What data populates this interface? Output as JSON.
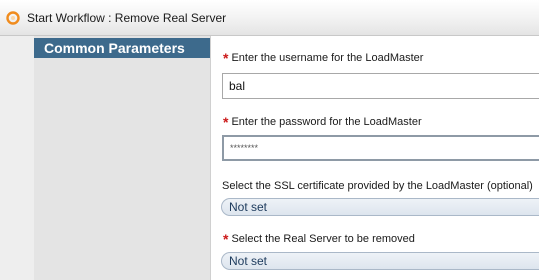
{
  "window": {
    "title": "Start Workflow : Remove Real Server"
  },
  "sidebar": {
    "items": [
      {
        "label": "Common Parameters"
      }
    ]
  },
  "form": {
    "username": {
      "label": "Enter the username for the LoadMaster",
      "required_marker": "*",
      "value": "bal"
    },
    "password": {
      "label": "Enter the password for the LoadMaster",
      "required_marker": "*",
      "value": "********"
    },
    "ssl_certificate": {
      "label": "Select the SSL certificate provided by the LoadMaster (optional)",
      "value": "Not set"
    },
    "real_server": {
      "label": "Select the Real Server to be removed",
      "required_marker": "*",
      "value": "Not set"
    }
  },
  "colors": {
    "nav_selected_bg": "#3d6a8c",
    "required_marker": "#cc1a1a",
    "icon_orange": "#f08c1e"
  },
  "icons": {
    "title": "workflow-icon"
  }
}
